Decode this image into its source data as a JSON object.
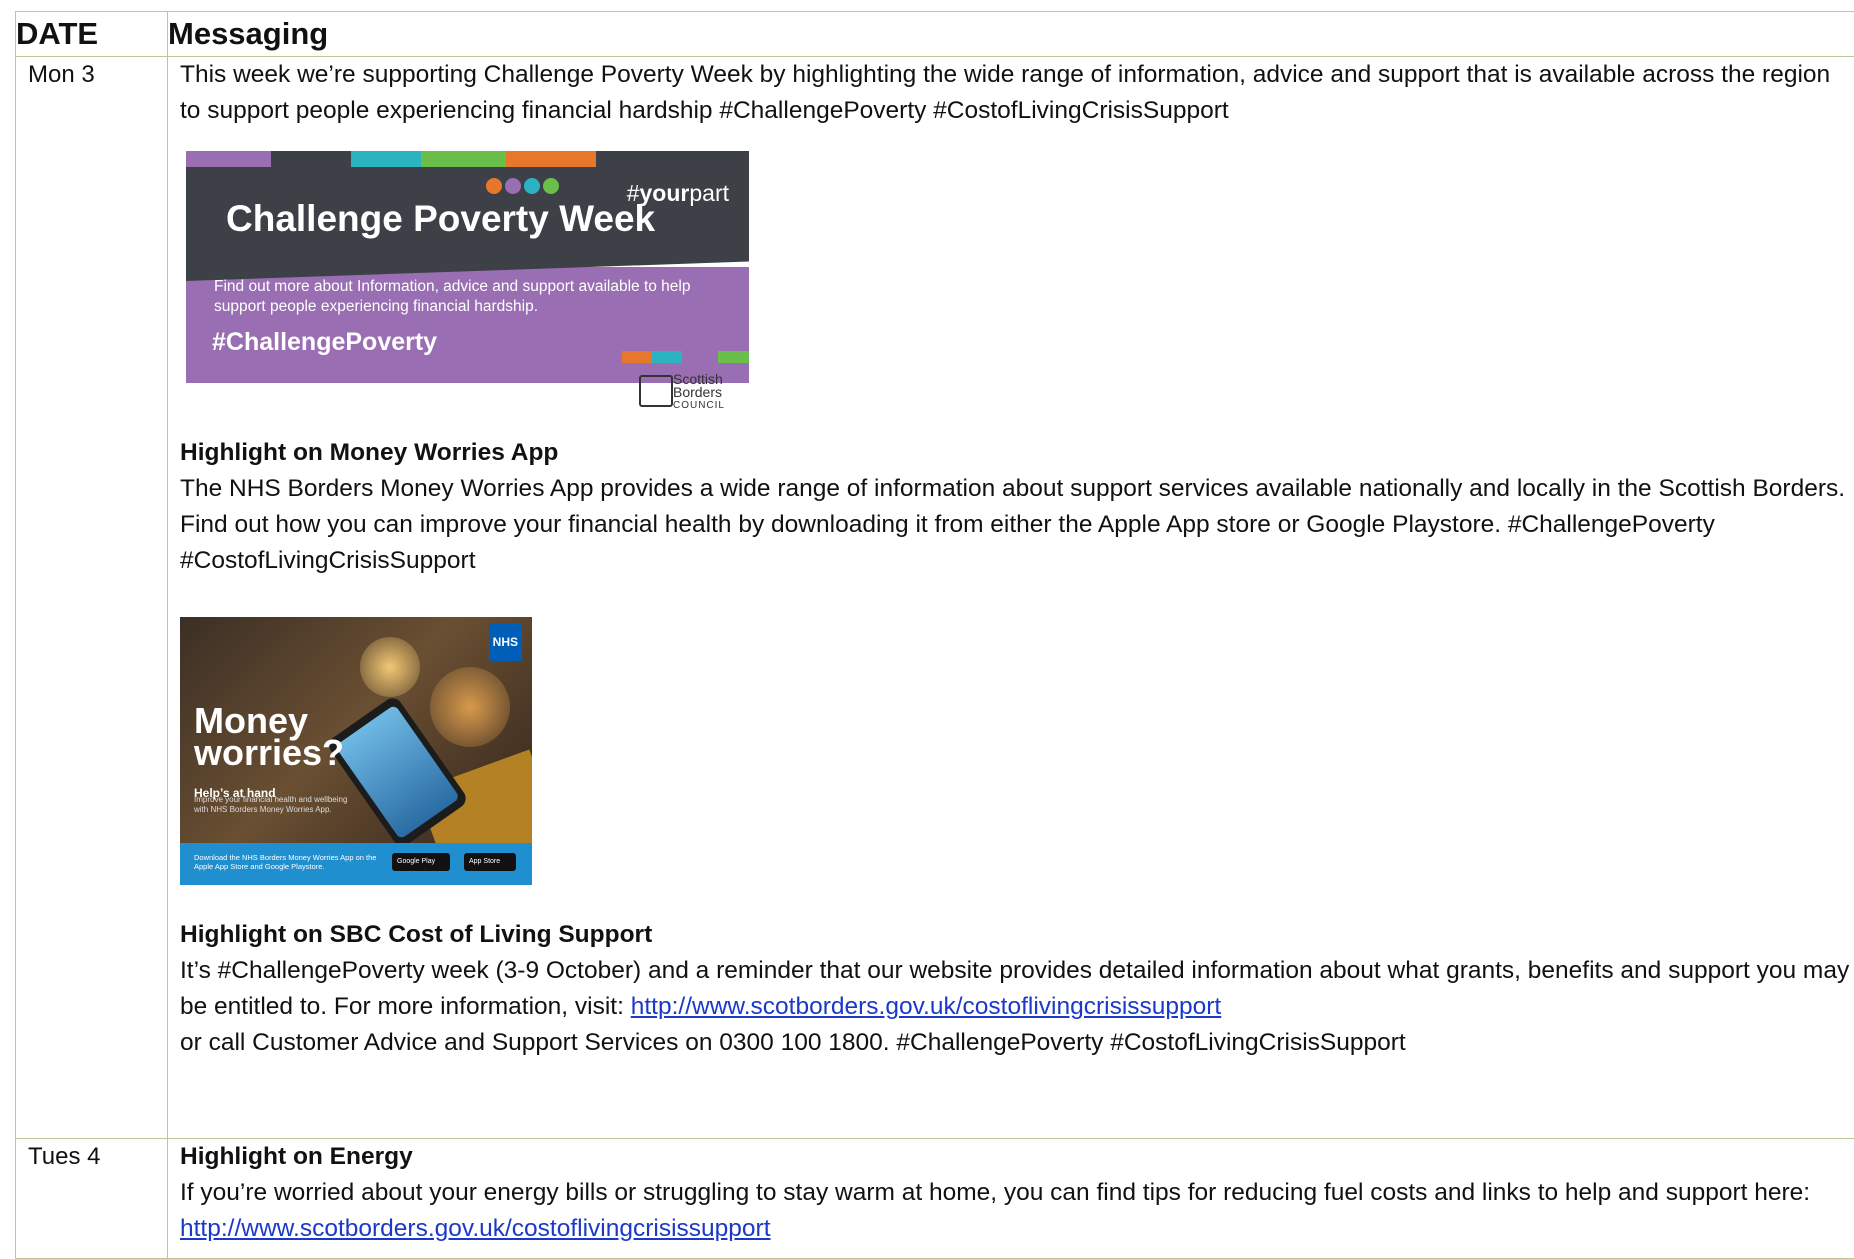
{
  "table": {
    "header": {
      "date": "DATE",
      "messaging": "Messaging"
    },
    "rows": [
      {
        "date": "Mon 3",
        "intro": "This week we’re supporting Challenge Poverty Week by highlighting the wide range of information, advice and support that is available across the region to support people experiencing financial hardship #ChallengePoverty #CostofLivingCrisisSupport",
        "banner": {
          "yourpart_hash": "#",
          "yourpart_bold": "your",
          "yourpart_rest": "part",
          "title": "Challenge Poverty Week",
          "description": "Find out more about Information, advice and support available to help support people experiencing financial hardship.",
          "hashtag": "#ChallengePoverty",
          "council_line1": "Scottish",
          "council_line2": "Borders",
          "council_line3": "COUNCIL",
          "stripe_colors": [
            "#9a6eb2",
            "#2bb3c2",
            "#6abf4b",
            "#e8772e"
          ]
        },
        "section1": {
          "title": "Highlight on Money Worries App",
          "body": "The NHS Borders Money Worries App provides a wide range of information about support services available nationally and locally in the Scottish Borders. Find out how you can improve your financial health by downloading it from either the Apple App store or Google Playstore. #ChallengePoverty #CostofLivingCrisisSupport"
        },
        "money_image": {
          "nhs": "NHS",
          "headline_1": "Money",
          "headline_2": "worries?",
          "subhead": "Help’s at hand",
          "body": "Improve your financial health and wellbeing with NHS Borders Money Worries App.",
          "download": "Download the NHS Borders Money Worries App on the Apple App Store and Google Playstore.",
          "google_play": "Google Play",
          "app_store": "App Store"
        },
        "section2": {
          "title": "Highlight on SBC Cost of Living Support",
          "body_before_link": "It’s #ChallengePoverty week (3-9 October) and a reminder that our website provides detailed information about what grants, benefits and support you may be entitled to. For more information, visit: ",
          "link": "http://www.scotborders.gov.uk/costoflivingcrisissupport",
          "body_after_link": "or call Customer Advice and Support Services on 0300 100 1800. #ChallengePoverty #CostofLivingCrisisSupport"
        }
      },
      {
        "date": "Tues 4",
        "section": {
          "title": "Highlight on Energy",
          "body_before_link": "If you’re worried about your energy bills or struggling to stay warm at home, you can find tips for reducing fuel costs and links to help and support here: ",
          "link": "http://www.scotborders.gov.uk/costoflivingcrisissupport"
        }
      }
    ]
  }
}
